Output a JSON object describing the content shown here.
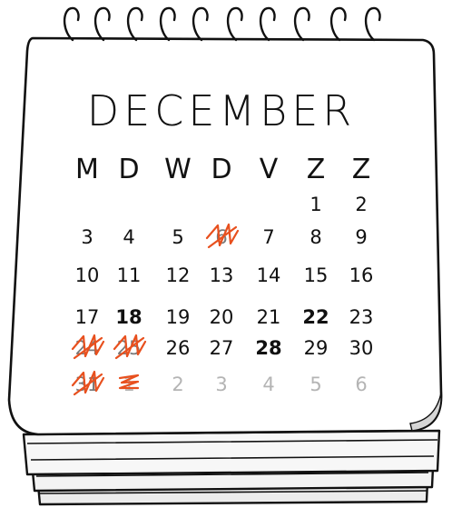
{
  "calendar": {
    "month": "DECEMBER",
    "weekdays": [
      "M",
      "D",
      "W",
      "D",
      "V",
      "Z",
      "Z"
    ],
    "weeks": [
      [
        {
          "day": ""
        },
        {
          "day": ""
        },
        {
          "day": ""
        },
        {
          "day": ""
        },
        {
          "day": ""
        },
        {
          "day": "1"
        },
        {
          "day": "2"
        }
      ],
      [
        {
          "day": "3"
        },
        {
          "day": "4"
        },
        {
          "day": "5"
        },
        {
          "day": "6",
          "crossed_out": true
        },
        {
          "day": "7"
        },
        {
          "day": "8"
        },
        {
          "day": "9"
        }
      ],
      [
        {
          "day": "10"
        },
        {
          "day": "11"
        },
        {
          "day": "12"
        },
        {
          "day": "13"
        },
        {
          "day": "14"
        },
        {
          "day": "15"
        },
        {
          "day": "16"
        }
      ],
      [
        {
          "day": "17"
        },
        {
          "day": "18",
          "bold": true
        },
        {
          "day": "19"
        },
        {
          "day": "20"
        },
        {
          "day": "21"
        },
        {
          "day": "22",
          "bold": true
        },
        {
          "day": "23"
        }
      ],
      [
        {
          "day": "24",
          "crossed_out": true
        },
        {
          "day": "25",
          "crossed_out": true
        },
        {
          "day": "26"
        },
        {
          "day": "27"
        },
        {
          "day": "28",
          "bold": true
        },
        {
          "day": "29"
        },
        {
          "day": "30"
        }
      ],
      [
        {
          "day": "31",
          "crossed_out": true
        },
        {
          "day": "1",
          "next_month": true,
          "crossed_out": true
        },
        {
          "day": "2",
          "next_month": true
        },
        {
          "day": "3",
          "next_month": true
        },
        {
          "day": "4",
          "next_month": true
        },
        {
          "day": "5",
          "next_month": true
        },
        {
          "day": "6",
          "next_month": true
        }
      ]
    ]
  },
  "colors": {
    "ink": "#111111",
    "faded_ink": "#b4b4b4",
    "cross_out": "#e8501e",
    "paper": "#ffffff",
    "page_edge_shadow": "#d6d6d6"
  }
}
